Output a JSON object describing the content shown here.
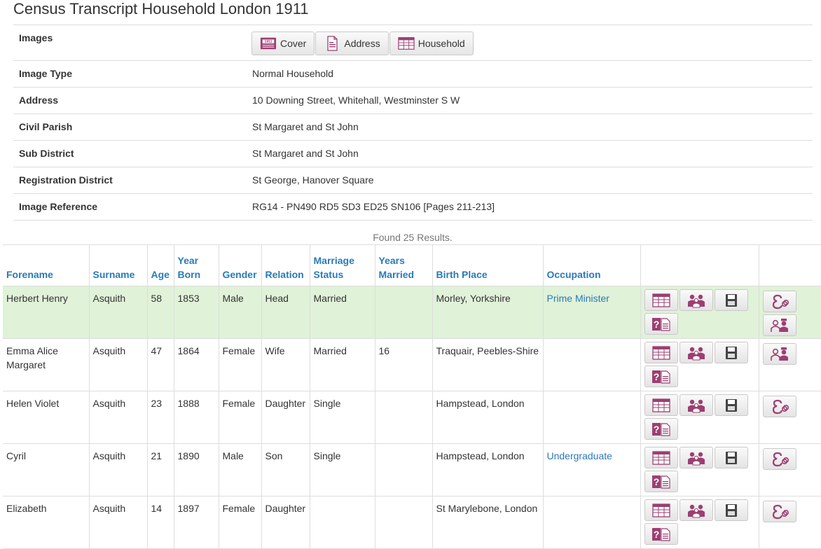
{
  "page": {
    "title": "Census Transcript Household London 1911"
  },
  "details": {
    "images_label": "Images",
    "buttons": {
      "cover": "Cover",
      "address": "Address",
      "household": "Household"
    },
    "cover_badge": "1911",
    "rows": [
      {
        "label": "Image Type",
        "value": "Normal Household"
      },
      {
        "label": "Address",
        "value": "10 Downing Street, Whitehall, Westminster S W"
      },
      {
        "label": "Civil Parish",
        "value": "St Margaret and St John"
      },
      {
        "label": "Sub District",
        "value": "St Margaret and St John"
      },
      {
        "label": "Registration District",
        "value": "St George, Hanover Square"
      },
      {
        "label": "Image Reference",
        "value": "RG14 - PN490 RD5 SD3 ED25 SN106 [Pages 211-213]"
      }
    ]
  },
  "results": {
    "found_text": "Found 25 Results.",
    "columns": {
      "forename": "Forename",
      "surname": "Surname",
      "age": "Age",
      "year_born": "Year Born",
      "gender": "Gender",
      "relation": "Relation",
      "marriage_status": "Marriage Status",
      "years_married": "Years Married",
      "birth_place": "Birth Place",
      "occupation": "Occupation"
    },
    "rows": [
      {
        "forename": "Herbert Henry",
        "surname": "Asquith",
        "age": "58",
        "year_born": "1853",
        "gender": "Male",
        "relation": "Head",
        "marriage_status": "Married",
        "years_married": "",
        "birth_place": "Morley, Yorkshire",
        "occupation": "Prime Minister",
        "highlight": true,
        "extra_icons": [
          "spouse-icon",
          "parents-icon"
        ]
      },
      {
        "forename": "Emma Alice Margaret",
        "surname": "Asquith",
        "age": "47",
        "year_born": "1864",
        "gender": "Female",
        "relation": "Wife",
        "marriage_status": "Married",
        "years_married": "16",
        "birth_place": "Traquair, Peebles-Shire",
        "occupation": "",
        "highlight": false,
        "extra_icons": [
          "parents-icon"
        ]
      },
      {
        "forename": "Helen Violet",
        "surname": "Asquith",
        "age": "23",
        "year_born": "1888",
        "gender": "Female",
        "relation": "Daughter",
        "marriage_status": "Single",
        "years_married": "",
        "birth_place": "Hampstead, London",
        "occupation": "",
        "highlight": false,
        "extra_icons": [
          "spouse-icon"
        ]
      },
      {
        "forename": "Cyril",
        "surname": "Asquith",
        "age": "21",
        "year_born": "1890",
        "gender": "Male",
        "relation": "Son",
        "marriage_status": "Single",
        "years_married": "",
        "birth_place": "Hampstead, London",
        "occupation": "Undergraduate",
        "highlight": false,
        "extra_icons": [
          "spouse-icon"
        ]
      },
      {
        "forename": "Elizabeth",
        "surname": "Asquith",
        "age": "14",
        "year_born": "1897",
        "gender": "Female",
        "relation": "Daughter",
        "marriage_status": "",
        "years_married": "",
        "birth_place": "St Marylebone, London",
        "occupation": "",
        "highlight": false,
        "extra_icons": [
          "spouse-icon"
        ]
      }
    ]
  },
  "colors": {
    "accent": "#2a7ab8",
    "icon": "#9c3f72",
    "highlight_row": "#e0f2d8"
  }
}
